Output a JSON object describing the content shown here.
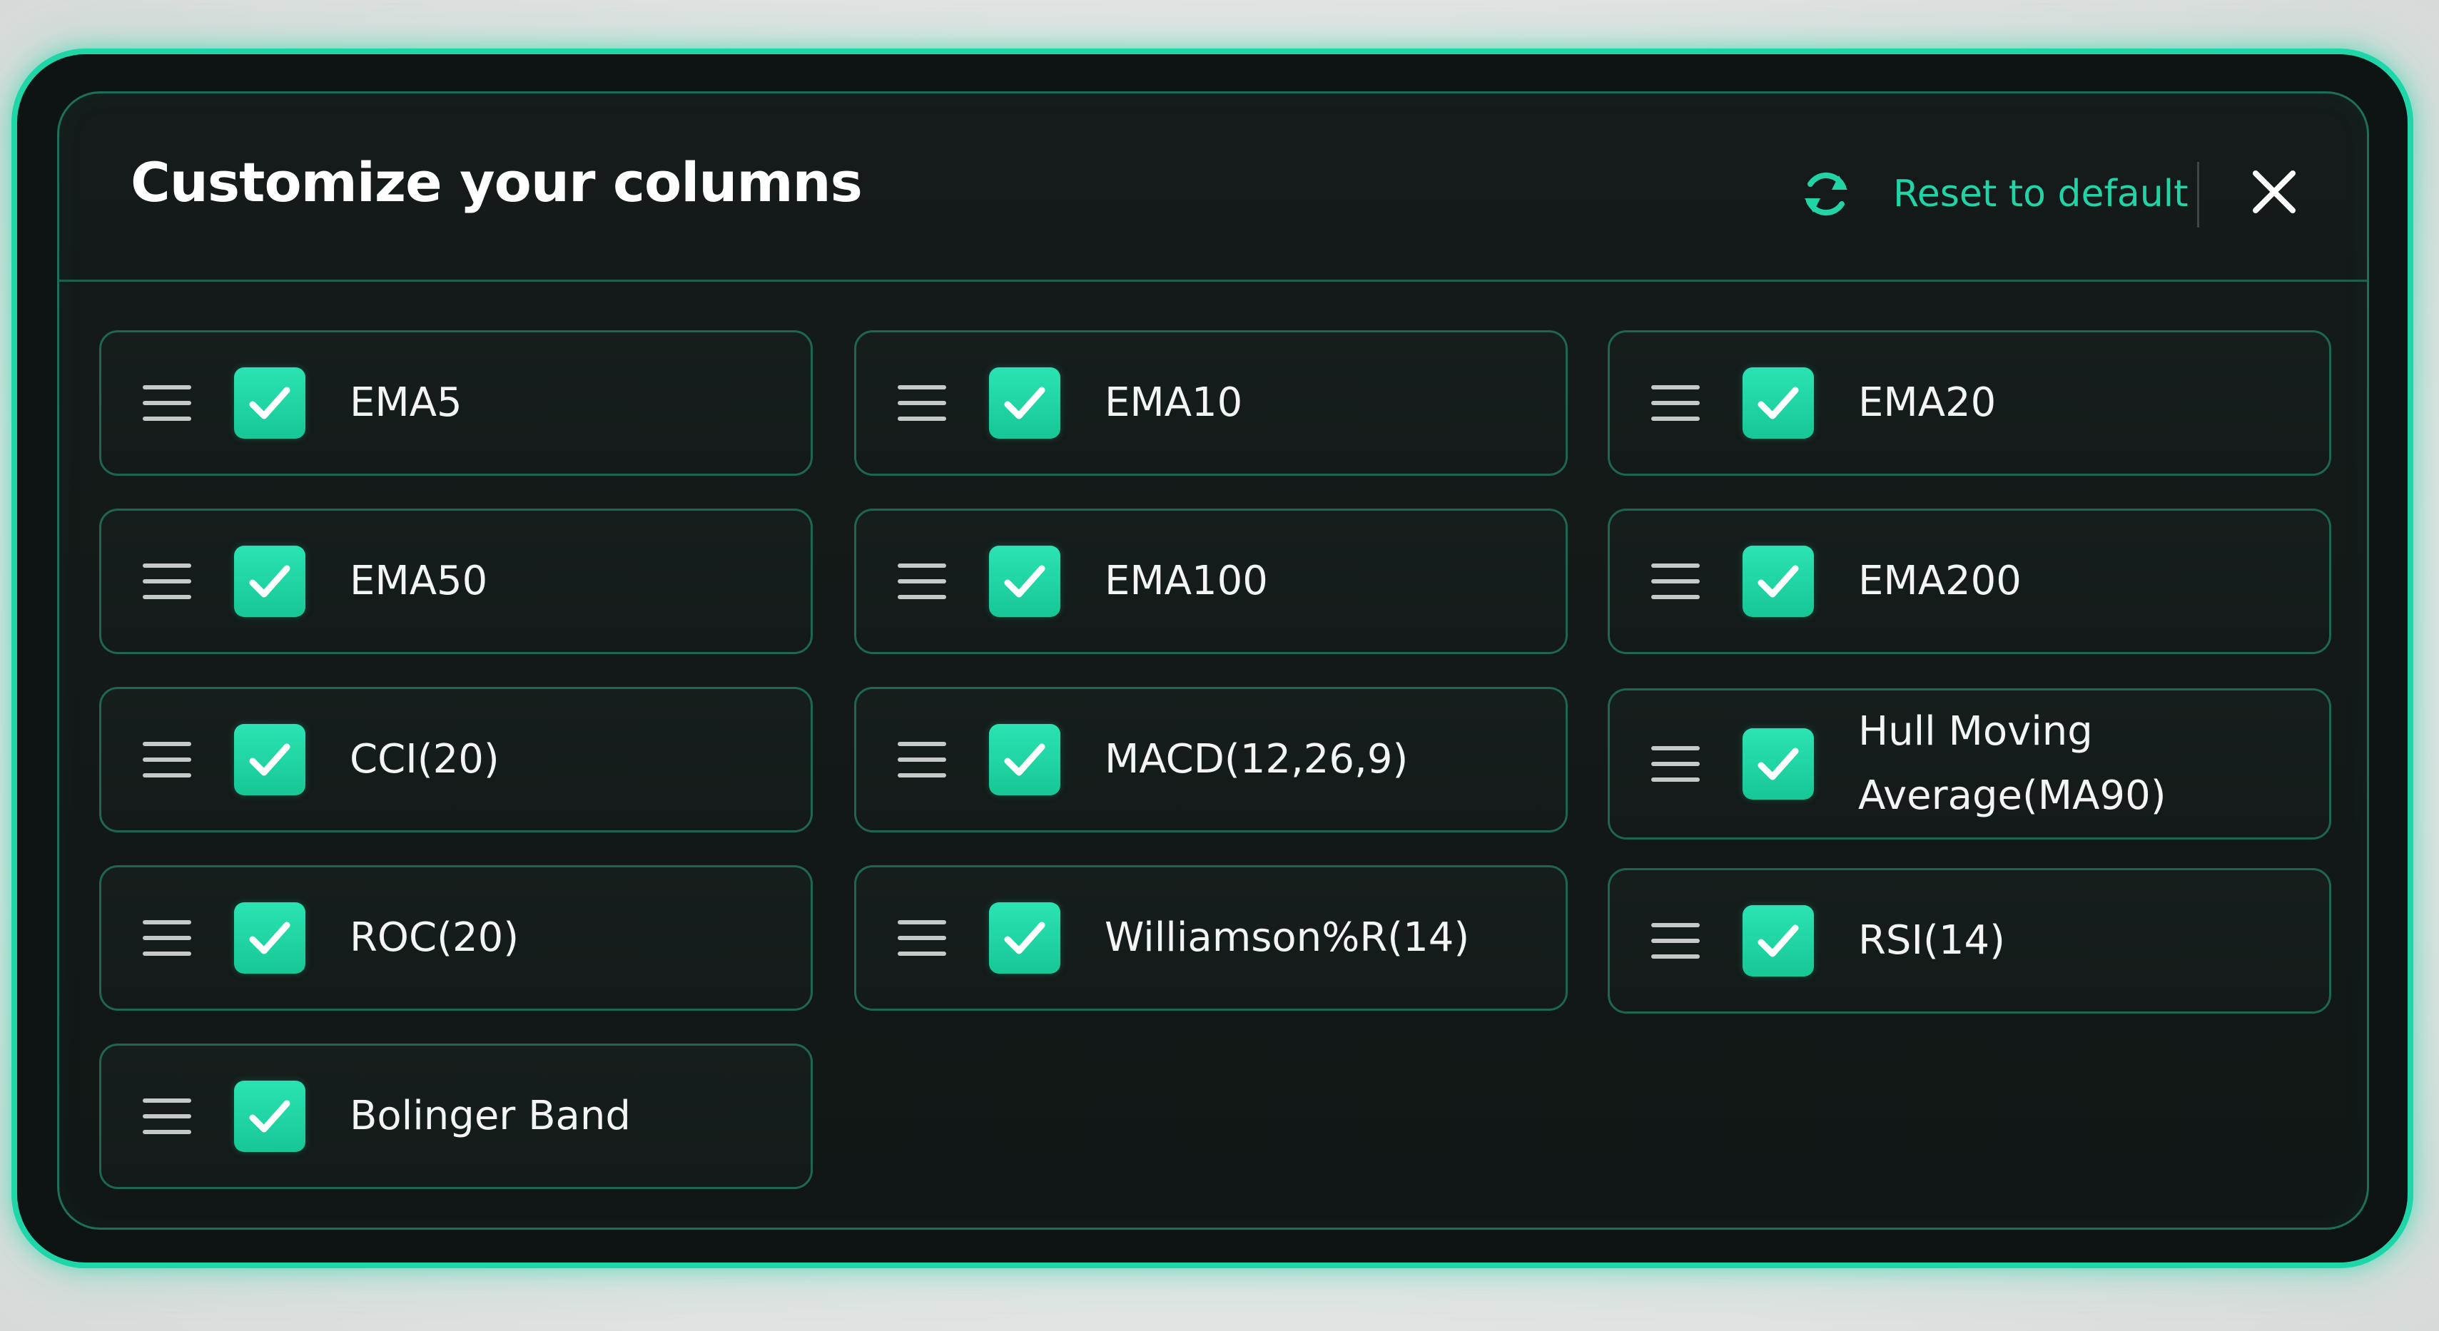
{
  "dialog": {
    "title": "Customize your columns",
    "reset_label": "Reset to default",
    "reset_icon": "refresh-icon",
    "close_icon": "close-icon",
    "accent_color": "#22d3a6"
  },
  "columns": [
    {
      "label": "EMA5",
      "checked": true
    },
    {
      "label": "EMA10",
      "checked": true
    },
    {
      "label": "EMA20",
      "checked": true
    },
    {
      "label": "EMA50",
      "checked": true
    },
    {
      "label": "EMA100",
      "checked": true
    },
    {
      "label": "EMA200",
      "checked": true
    },
    {
      "label": "CCI(20)",
      "checked": true
    },
    {
      "label": "MACD(12,26,9)",
      "checked": true
    },
    {
      "label": "Hull Moving Average(MA90)",
      "checked": true
    },
    {
      "label": "ROC(20)",
      "checked": true
    },
    {
      "label": "Williamson%R(14)",
      "checked": true
    },
    {
      "label": "RSI(14)",
      "checked": true
    },
    {
      "label": "Bolinger Band",
      "checked": true
    }
  ]
}
